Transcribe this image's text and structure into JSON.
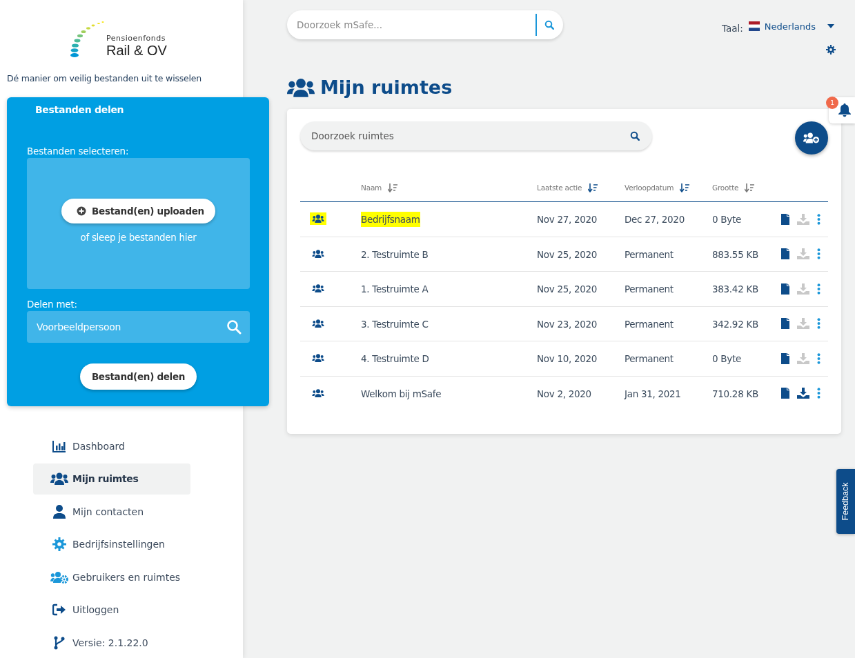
{
  "logo": {
    "line1": "Pensioenfonds",
    "line2": "Rail & OV"
  },
  "tagline": "Dé manier om veilig bestanden uit te wisselen",
  "share_panel": {
    "title": "Bestanden delen",
    "select_label": "Bestanden selecteren:",
    "upload_button": "Bestand(en) uploaden",
    "drop_hint": "of sleep je bestanden hier",
    "share_with_label": "Delen met:",
    "share_with_placeholder": "Voorbeeldpersoon",
    "share_button": "Bestand(en) delen"
  },
  "nav": [
    {
      "kind": "chart",
      "label": "Dashboard",
      "selected": false
    },
    {
      "kind": "users",
      "label": "Mijn ruimtes",
      "selected": true
    },
    {
      "kind": "user",
      "label": "Mijn contacten",
      "selected": false
    },
    {
      "kind": "gear",
      "label": "Bedrijfsinstellingen",
      "selected": false
    },
    {
      "kind": "users-gear",
      "label": "Gebruikers en ruimtes",
      "selected": false
    },
    {
      "kind": "logout",
      "label": "Uitloggen",
      "selected": false
    },
    {
      "kind": "branch",
      "label": "Versie: 2.1.22.0",
      "selected": false
    }
  ],
  "top_search": {
    "placeholder": "Doorzoek mSafe..."
  },
  "language": {
    "label": "Taal:",
    "value": "Nederlands"
  },
  "notifications": {
    "count": "1"
  },
  "page_title": "Mijn ruimtes",
  "spaces": {
    "search_placeholder": "Doorzoek ruimtes",
    "columns": [
      "Naam",
      "Laatste actie",
      "Verloopdatum",
      "Grootte"
    ],
    "rows": [
      {
        "name": "Bedrijfsnaam",
        "last_action": "Nov 27, 2020",
        "expires": "Dec 27, 2020",
        "size": "0 Byte",
        "download_enabled": false,
        "highlighted": true
      },
      {
        "name": "2. Testruimte B",
        "last_action": "Nov 25, 2020",
        "expires": "Permanent",
        "size": "883.55 KB",
        "download_enabled": false,
        "highlighted": false
      },
      {
        "name": "1. Testruimte A",
        "last_action": "Nov 25, 2020",
        "expires": "Permanent",
        "size": "383.42 KB",
        "download_enabled": false,
        "highlighted": false
      },
      {
        "name": "3. Testruimte C",
        "last_action": "Nov 23, 2020",
        "expires": "Permanent",
        "size": "342.92 KB",
        "download_enabled": false,
        "highlighted": false
      },
      {
        "name": "4. Testruimte D",
        "last_action": "Nov 10, 2020",
        "expires": "Permanent",
        "size": "0 Byte",
        "download_enabled": false,
        "highlighted": false
      },
      {
        "name": "Welkom bij mSafe",
        "last_action": "Nov 2, 2020",
        "expires": "Jan 31, 2021",
        "size": "710.28 KB",
        "download_enabled": true,
        "highlighted": false
      }
    ]
  },
  "feedback_tab": "Feedback"
}
